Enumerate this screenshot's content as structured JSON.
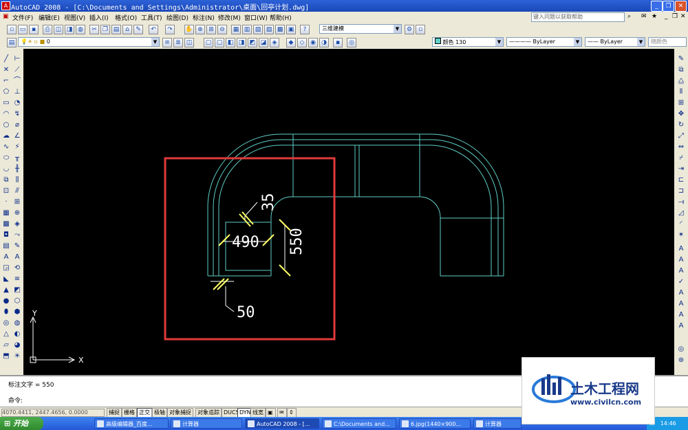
{
  "window": {
    "title": "AutoCAD 2008 - [C:\\Documents and Settings\\Administrator\\桌面\\回亭计划.dwg]",
    "buttons": {
      "minimize": "_",
      "restore": "❐",
      "close": "✕"
    }
  },
  "menu": {
    "items": [
      "文件(F)",
      "编辑(E)",
      "视图(V)",
      "插入(I)",
      "格式(O)",
      "工具(T)",
      "绘图(D)",
      "标注(N)",
      "修改(M)",
      "窗口(W)",
      "帮助(H)"
    ],
    "help_placeholder": "键入问题以获取帮助"
  },
  "toolbar": {
    "workspace": "三维建模",
    "layer": "0",
    "color": "颜色 130",
    "linetype": "ByLayer",
    "lineweight": "ByLayer",
    "plotstyle": "随颜色"
  },
  "drawing": {
    "dims": {
      "d35": "35",
      "d490": "490",
      "d550": "550",
      "d50": "50"
    },
    "ucs": {
      "x": "X",
      "y": "Y"
    },
    "colors": {
      "geometry": "#5fd0c8",
      "dimension": "#ffffff",
      "tick": "#ffff66",
      "highlight": "#e03a3a"
    }
  },
  "command": {
    "history": "标注文字 = 550",
    "prompt": "命令:"
  },
  "status": {
    "coords": "4070.4411, 2447.4656, 0.0000",
    "toggles": [
      "捕捉",
      "栅格",
      "正交",
      "极轴",
      "对象捕捉",
      "对象追踪",
      "DUCS",
      "DYN",
      "线宽"
    ]
  },
  "taskbar": {
    "start": "开始",
    "tasks": [
      "高级编辑器_百度...",
      "计算器",
      "AutoCAD 2008 - [...",
      "C:\\Documents and...",
      "6.jpg(1440×900...",
      "计算器"
    ],
    "clock": "14:46"
  },
  "watermark": {
    "title": "土木工程网",
    "url": "www.civilcn.com"
  }
}
